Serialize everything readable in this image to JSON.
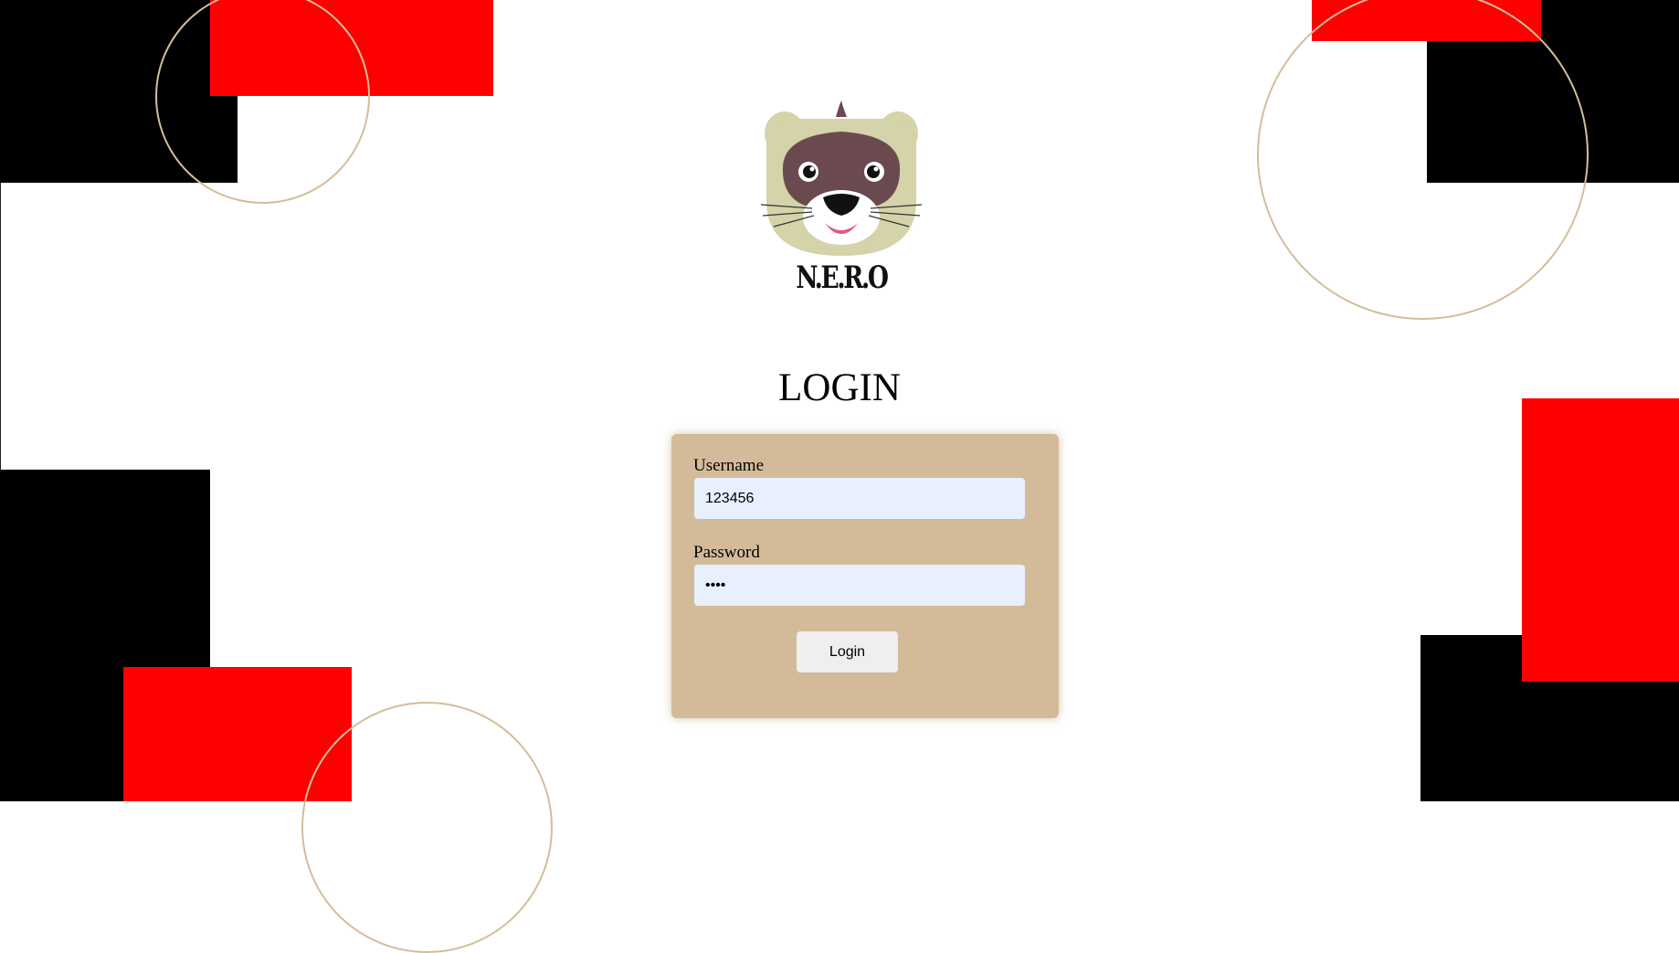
{
  "brand": {
    "name": "N.E.R.O"
  },
  "login": {
    "title": "LOGIN",
    "username_label": "Username",
    "username_value": "123456",
    "password_label": "Password",
    "password_value": "1234",
    "button_label": "Login"
  },
  "colors": {
    "card": "#d3bb9a",
    "input": "#e8f0fe",
    "accent_red": "#ff0000",
    "accent_black": "#000000",
    "ring": "#d5bd9a"
  },
  "icons": {
    "logo": "ferret-mascot-icon"
  }
}
